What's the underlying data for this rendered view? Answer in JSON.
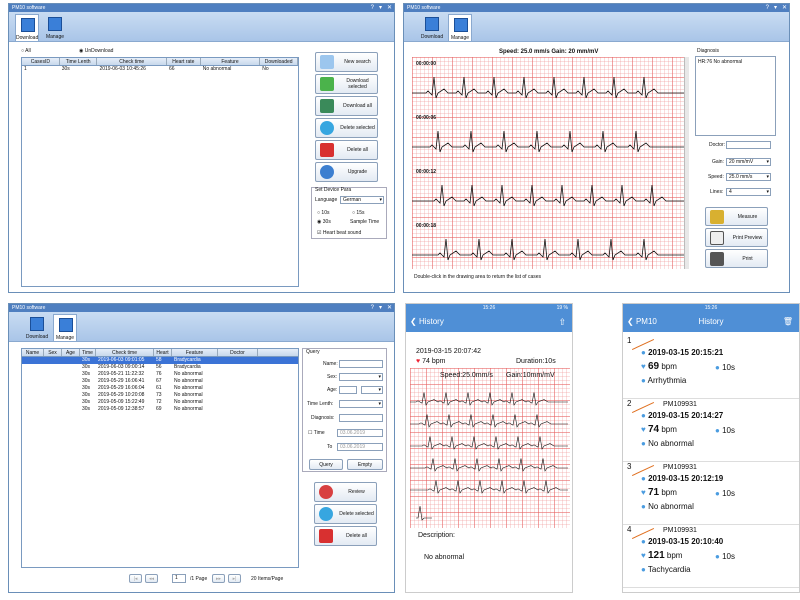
{
  "app_title": "PM10 software",
  "tabs": {
    "download": "Download",
    "manage": "Manage"
  },
  "w1": {
    "radio_all": "All",
    "radio_undownload": "UnDownload",
    "columns": [
      "CasesID",
      "Time Lenth",
      "Check time",
      "Heart rate",
      "Feature",
      "Downloaded"
    ],
    "row": [
      "1",
      "30s",
      "2019-06-03 10:45:26",
      "66",
      "No abnormal",
      "No"
    ],
    "buttons": {
      "new_search": "New search",
      "download_selected": "Download selected",
      "download_all": "Download all",
      "delete_selected": "Delete selected",
      "delete_all": "Delete all",
      "upgrade": "Upgrade"
    },
    "set_device": "Set Device Para",
    "language_label": "Language",
    "language_value": "German",
    "opt_10s": "10s",
    "opt_15s": "15s",
    "opt_30s": "30s",
    "sample_time": "Sample Time",
    "heartbeat": "Heart beat sound"
  },
  "w2": {
    "speed_gain": "Speed: 25.0 mm/s  Gain: 20 mm/mV",
    "times": [
      "00:00:00",
      "00:00:06",
      "00:00:12",
      "00:00:18"
    ],
    "hint": "Double-click in the drawing area to return the list of cases",
    "diagnosis_label": "Diagnosis",
    "diagnosis_value": "HR:76  No abnormal",
    "doctor_label": "Doctor:",
    "gain_label": "Gain:",
    "gain_value": "20 mm/mV",
    "speed_label": "Speed:",
    "speed_value": "25.0 mm/s",
    "lines_label": "Lines:",
    "lines_value": "4",
    "measure": "Measure",
    "print_preview": "Print Preview",
    "print": "Print"
  },
  "w3": {
    "columns": [
      "Name",
      "Sex",
      "Age",
      "Time",
      "Check time",
      "Heart",
      "Feature",
      "Doctor"
    ],
    "rows": [
      [
        "",
        "",
        "",
        "30s",
        "2019-06-03 09:01:05",
        "58",
        "Bradycardia",
        ""
      ],
      [
        "",
        "",
        "",
        "30s",
        "2019-06-03 09:00:14",
        "56",
        "Bradycardia",
        ""
      ],
      [
        "",
        "",
        "",
        "30s",
        "2019-05-21 11:22:32",
        "76",
        "No abnormal",
        ""
      ],
      [
        "",
        "",
        "",
        "30s",
        "2019-05-29 16:06:41",
        "67",
        "No abnormal",
        ""
      ],
      [
        "",
        "",
        "",
        "30s",
        "2019-05-29 16:06:04",
        "61",
        "No abnormal",
        ""
      ],
      [
        "",
        "",
        "",
        "30s",
        "2019-05-29 10:20:08",
        "73",
        "No abnormal",
        ""
      ],
      [
        "",
        "",
        "",
        "30s",
        "2019-05-09 15:22:49",
        "72",
        "No abnormal",
        ""
      ],
      [
        "",
        "",
        "",
        "30s",
        "2019-05-09 12:38:57",
        "69",
        "No abnormal",
        ""
      ]
    ],
    "query_title": "Query",
    "q_name": "Name:",
    "q_sex": "Sex:",
    "q_age": "Age:",
    "q_timelen": "Time Lenth:",
    "q_diag": "Diagnosis:",
    "q_time": "Time",
    "q_to": "To",
    "q_date1": "03.06.2019",
    "q_date2": "03.06.2019",
    "query_btn": "Query",
    "empty_btn": "Empty",
    "review": "Review",
    "delete_selected": "Delete selected",
    "delete_all": "Delete all",
    "page_value": "1",
    "page_total": "/1 Page",
    "items_per_page": "20 Items/Page"
  },
  "p1": {
    "status_time": "15:26",
    "battery": "19 %",
    "back": "History",
    "datetime": "2019-03-15 20:07:42",
    "bpm": "74 bpm",
    "duration": "Duration:10s",
    "speed": "Speed:25.0mm/s",
    "gain": "Gain:10mm/mV",
    "desc_label": "Description:",
    "desc_value": "No abnormal"
  },
  "p2": {
    "status_time": "15:26",
    "back": "PM10",
    "title": "History",
    "cards": [
      {
        "index": "1",
        "device": "",
        "datetime": "2019-03-15 20:15:21",
        "bpm": "69",
        "unit": "bpm",
        "dur": "10s",
        "label": "Arrhythmia"
      },
      {
        "index": "2",
        "device": "PM109931",
        "datetime": "2019-03-15 20:14:27",
        "bpm": "74",
        "unit": "bpm",
        "dur": "10s",
        "label": "No abnormal"
      },
      {
        "index": "3",
        "device": "PM109931",
        "datetime": "2019-03-15 20:12:19",
        "bpm": "71",
        "unit": "bpm",
        "dur": "10s",
        "label": "No abnormal"
      },
      {
        "index": "4",
        "device": "PM109931",
        "datetime": "2019-03-15 20:10:40",
        "bpm": "121",
        "unit": "bpm",
        "dur": "10s",
        "label": "Tachycardia"
      }
    ]
  }
}
